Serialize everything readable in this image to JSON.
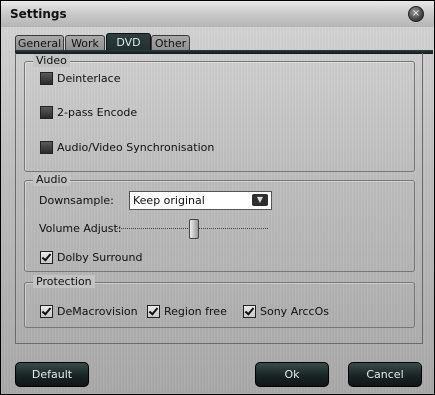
{
  "window": {
    "title": "Settings",
    "close_glyph": "×"
  },
  "tabs": [
    {
      "label": "General",
      "active": false
    },
    {
      "label": "Work",
      "active": false
    },
    {
      "label": "DVD",
      "active": true
    },
    {
      "label": "Other",
      "active": false
    }
  ],
  "video": {
    "legend": "Video",
    "deinterlace": {
      "label": "Deinterlace",
      "checked": false
    },
    "two_pass": {
      "label": "2-pass Encode",
      "checked": false
    },
    "av_sync": {
      "label": "Audio/Video Synchronisation",
      "checked": false
    }
  },
  "audio": {
    "legend": "Audio",
    "downsample_label": "Downsample:",
    "downsample_value": "Keep original",
    "volume_label": "Volume Adjust:",
    "volume_level": 0.5,
    "dolby": {
      "label": "Dolby Surround",
      "checked": true
    }
  },
  "protection": {
    "legend": "Protection",
    "demacrovision": {
      "label": "DeMacrovision",
      "checked": true
    },
    "region_free": {
      "label": "Region free",
      "checked": true
    },
    "sony_arccos": {
      "label": "Sony ArccOs",
      "checked": true
    }
  },
  "buttons": {
    "default": "Default",
    "ok": "Ok",
    "cancel": "Cancel"
  },
  "colors": {
    "accent_dark": "#1f2c2c",
    "tab_active_text": "#d8e8e8"
  }
}
